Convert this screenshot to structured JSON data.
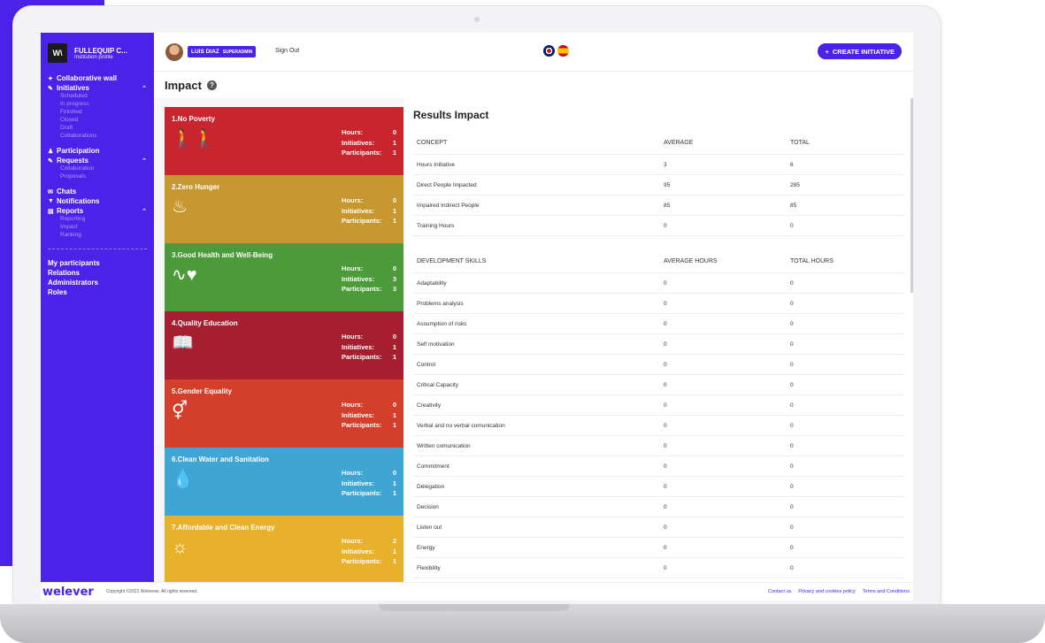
{
  "colors": {
    "accent": "#4a22e8"
  },
  "sidebar": {
    "brand_name": "FULLEQUIP C...",
    "brand_sub": "Institution profile",
    "logo_text": "W\\",
    "groups": [
      {
        "label": "Collaborative wall",
        "icon": "spark-icon"
      },
      {
        "label": "Initiatives",
        "icon": "pencil-icon",
        "subs": [
          "Scheduled",
          "In progress",
          "Finished",
          "Closed",
          "Draft",
          "Collaborations"
        ]
      },
      {
        "label": "Participation",
        "icon": "user-icon"
      },
      {
        "label": "Requests",
        "icon": "pencil-icon",
        "subs": [
          "Collaboration",
          "Proposals"
        ]
      },
      {
        "label": "Chats",
        "icon": "chat-icon"
      },
      {
        "label": "Notifications",
        "icon": "filter-icon"
      },
      {
        "label": "Reports",
        "icon": "report-icon",
        "subs": [
          "Reporting",
          "Impact",
          "Ranking"
        ]
      }
    ],
    "bottom_links": [
      "My participants",
      "Relations",
      "Administrators",
      "Roles"
    ]
  },
  "header": {
    "user_name": "LUIS DIAZ",
    "user_role": "SUPERADMIN",
    "sign_out": "Sign Out",
    "create_label": "CREATE INITIATIVE"
  },
  "page_title": "Impact",
  "sdg_cards": [
    {
      "title": "1.No Poverty",
      "color": "#c9252e",
      "glyph": "🚶‍🚶",
      "hours": "0",
      "initiatives": "1",
      "participants": "1"
    },
    {
      "title": "2.Zero Hunger",
      "color": "#c7982f",
      "glyph": "♨",
      "hours": "0",
      "initiatives": "1",
      "participants": "1"
    },
    {
      "title": "3.Good Health and Well-Being",
      "color": "#4c9a3a",
      "glyph": "∿♥",
      "hours": "0",
      "initiatives": "3",
      "participants": "3"
    },
    {
      "title": "4.Quality Education",
      "color": "#a61f31",
      "glyph": "📖",
      "hours": "0",
      "initiatives": "1",
      "participants": "1"
    },
    {
      "title": "5.Gender Equality",
      "color": "#d43f2b",
      "glyph": "⚥",
      "hours": "0",
      "initiatives": "1",
      "participants": "1"
    },
    {
      "title": "6.Clean Water and Sanitation",
      "color": "#3fa6d4",
      "glyph": "💧",
      "hours": "0",
      "initiatives": "1",
      "participants": "1"
    },
    {
      "title": "7.Affordable and Clean Energy",
      "color": "#e7b12c",
      "glyph": "☼",
      "hours": "2",
      "initiatives": "1",
      "participants": "1"
    }
  ],
  "stat_labels": {
    "hours": "Hours:",
    "initiatives": "Initiatives:",
    "participants": "Participants:"
  },
  "results": {
    "title": "Results Impact",
    "concept_headers": [
      "CONCEPT",
      "AVERAGE",
      "TOTAL"
    ],
    "concepts": [
      [
        "Hours Initiative",
        "3",
        "6"
      ],
      [
        "Direct People Impacted",
        "95",
        "285"
      ],
      [
        "Impaired Indirect People",
        "85",
        "85"
      ],
      [
        "Training Hours",
        "0",
        "0"
      ]
    ],
    "skills_headers": [
      "DEVELOPMENT SKILLS",
      "AVERAGE HOURS",
      "TOTAL HOURS"
    ],
    "skills": [
      [
        "Adaptability",
        "0",
        "0"
      ],
      [
        "Problems analysis",
        "0",
        "0"
      ],
      [
        "Assumption of risks",
        "0",
        "0"
      ],
      [
        "Self motivation",
        "0",
        "0"
      ],
      [
        "Control",
        "0",
        "0"
      ],
      [
        "Critical Capacity",
        "0",
        "0"
      ],
      [
        "Creativity",
        "0",
        "0"
      ],
      [
        "Verbal and no verbal comunication",
        "0",
        "0"
      ],
      [
        "Written comunication",
        "0",
        "0"
      ],
      [
        "Commitment",
        "0",
        "0"
      ],
      [
        "Delegation",
        "0",
        "0"
      ],
      [
        "Decision",
        "0",
        "0"
      ],
      [
        "Listen out",
        "0",
        "0"
      ],
      [
        "Energy",
        "0",
        "0"
      ],
      [
        "Flexibility",
        "0",
        "0"
      ]
    ]
  },
  "footer": {
    "logo": "welever",
    "copyright": "Copyright ©2021 Weleever. All rights reserved.",
    "links": [
      "Contact us",
      "Privacy and cookies policy",
      "Terms and Conditions"
    ]
  }
}
